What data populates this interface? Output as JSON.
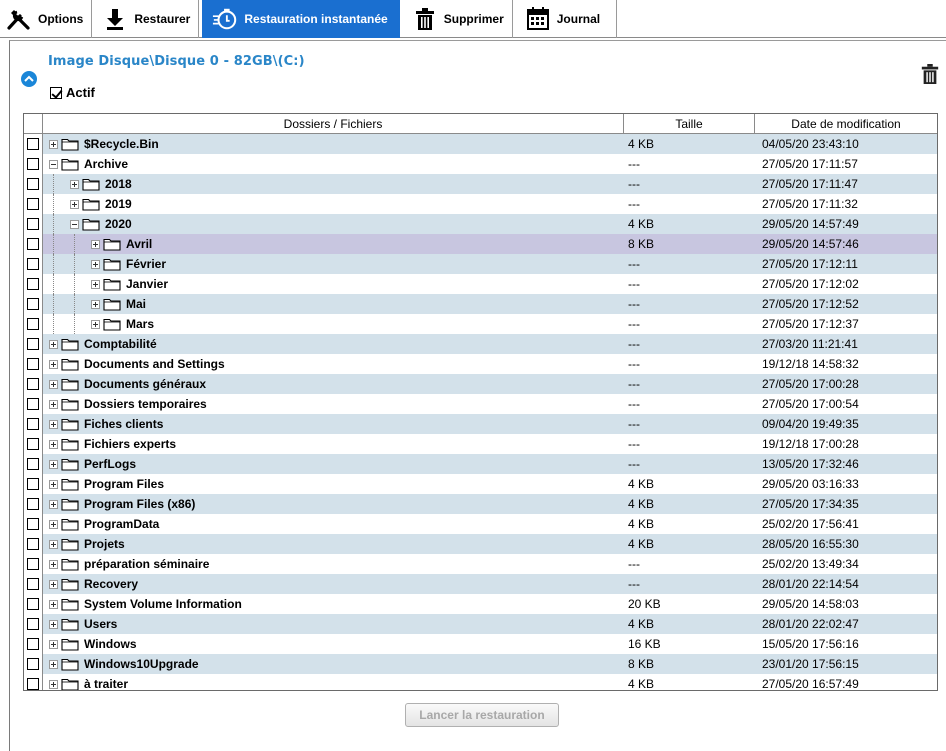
{
  "toolbar": {
    "options": "Options",
    "restaurer": "Restaurer",
    "restauration_instantanee": "Restauration instantanée",
    "supprimer": "Supprimer",
    "journal": "Journal"
  },
  "colors": {
    "accent": "#1a6fd0",
    "title": "#2a86c8",
    "row_alt": "#d3e1ea",
    "row_selected": "#c8c6e0"
  },
  "panel": {
    "title": "Image Disque\\Disque 0 - 82GB\\(C:)",
    "actif_label": "Actif"
  },
  "table": {
    "headers": {
      "name": "Dossiers / Fichiers",
      "size": "Taille",
      "date": "Date de modification"
    },
    "rows": [
      {
        "name": "$Recycle.Bin",
        "size": "4 KB",
        "date": "04/05/20 23:43:10",
        "depth": 0,
        "expanded": false
      },
      {
        "name": "Archive",
        "size": "---",
        "date": "27/05/20 17:11:57",
        "depth": 0,
        "expanded": true
      },
      {
        "name": "2018",
        "size": "---",
        "date": "27/05/20 17:11:47",
        "depth": 1,
        "expanded": false
      },
      {
        "name": "2019",
        "size": "---",
        "date": "27/05/20 17:11:32",
        "depth": 1,
        "expanded": false
      },
      {
        "name": "2020",
        "size": "4 KB",
        "date": "29/05/20 14:57:49",
        "depth": 1,
        "expanded": true
      },
      {
        "name": "Avril",
        "size": "8 KB",
        "date": "29/05/20 14:57:46",
        "depth": 2,
        "expanded": false,
        "selected": true
      },
      {
        "name": "Février",
        "size": "---",
        "date": "27/05/20 17:12:11",
        "depth": 2,
        "expanded": false
      },
      {
        "name": "Janvier",
        "size": "---",
        "date": "27/05/20 17:12:02",
        "depth": 2,
        "expanded": false
      },
      {
        "name": "Mai",
        "size": "---",
        "date": "27/05/20 17:12:52",
        "depth": 2,
        "expanded": false
      },
      {
        "name": "Mars",
        "size": "---",
        "date": "27/05/20 17:12:37",
        "depth": 2,
        "expanded": false
      },
      {
        "name": "Comptabilité",
        "size": "---",
        "date": "27/03/20 11:21:41",
        "depth": 0,
        "expanded": false
      },
      {
        "name": "Documents and Settings",
        "size": "---",
        "date": "19/12/18 14:58:32",
        "depth": 0,
        "expanded": false
      },
      {
        "name": "Documents généraux",
        "size": "---",
        "date": "27/05/20 17:00:28",
        "depth": 0,
        "expanded": false
      },
      {
        "name": "Dossiers temporaires",
        "size": "---",
        "date": "27/05/20 17:00:54",
        "depth": 0,
        "expanded": false
      },
      {
        "name": "Fiches clients",
        "size": "---",
        "date": "09/04/20 19:49:35",
        "depth": 0,
        "expanded": false
      },
      {
        "name": "Fichiers experts",
        "size": "---",
        "date": "19/12/18 17:00:28",
        "depth": 0,
        "expanded": false
      },
      {
        "name": "PerfLogs",
        "size": "---",
        "date": "13/05/20 17:32:46",
        "depth": 0,
        "expanded": false
      },
      {
        "name": "Program Files",
        "size": "4 KB",
        "date": "29/05/20 03:16:33",
        "depth": 0,
        "expanded": false
      },
      {
        "name": "Program Files (x86)",
        "size": "4 KB",
        "date": "27/05/20 17:34:35",
        "depth": 0,
        "expanded": false
      },
      {
        "name": "ProgramData",
        "size": "4 KB",
        "date": "25/02/20 17:56:41",
        "depth": 0,
        "expanded": false
      },
      {
        "name": "Projets",
        "size": "4 KB",
        "date": "28/05/20 16:55:30",
        "depth": 0,
        "expanded": false
      },
      {
        "name": "préparation séminaire",
        "size": "---",
        "date": "25/02/20 13:49:34",
        "depth": 0,
        "expanded": false
      },
      {
        "name": "Recovery",
        "size": "---",
        "date": "28/01/20 22:14:54",
        "depth": 0,
        "expanded": false
      },
      {
        "name": "System Volume Information",
        "size": "20 KB",
        "date": "29/05/20 14:58:03",
        "depth": 0,
        "expanded": false
      },
      {
        "name": "Users",
        "size": "4 KB",
        "date": "28/01/20 22:02:47",
        "depth": 0,
        "expanded": false
      },
      {
        "name": "Windows",
        "size": "16 KB",
        "date": "15/05/20 17:56:16",
        "depth": 0,
        "expanded": false
      },
      {
        "name": "Windows10Upgrade",
        "size": "8 KB",
        "date": "23/01/20 17:56:15",
        "depth": 0,
        "expanded": false
      },
      {
        "name": "à traiter",
        "size": "4 KB",
        "date": "27/05/20 16:57:49",
        "depth": 0,
        "expanded": false
      }
    ]
  },
  "footer": {
    "restore_button": "Lancer la restauration"
  }
}
